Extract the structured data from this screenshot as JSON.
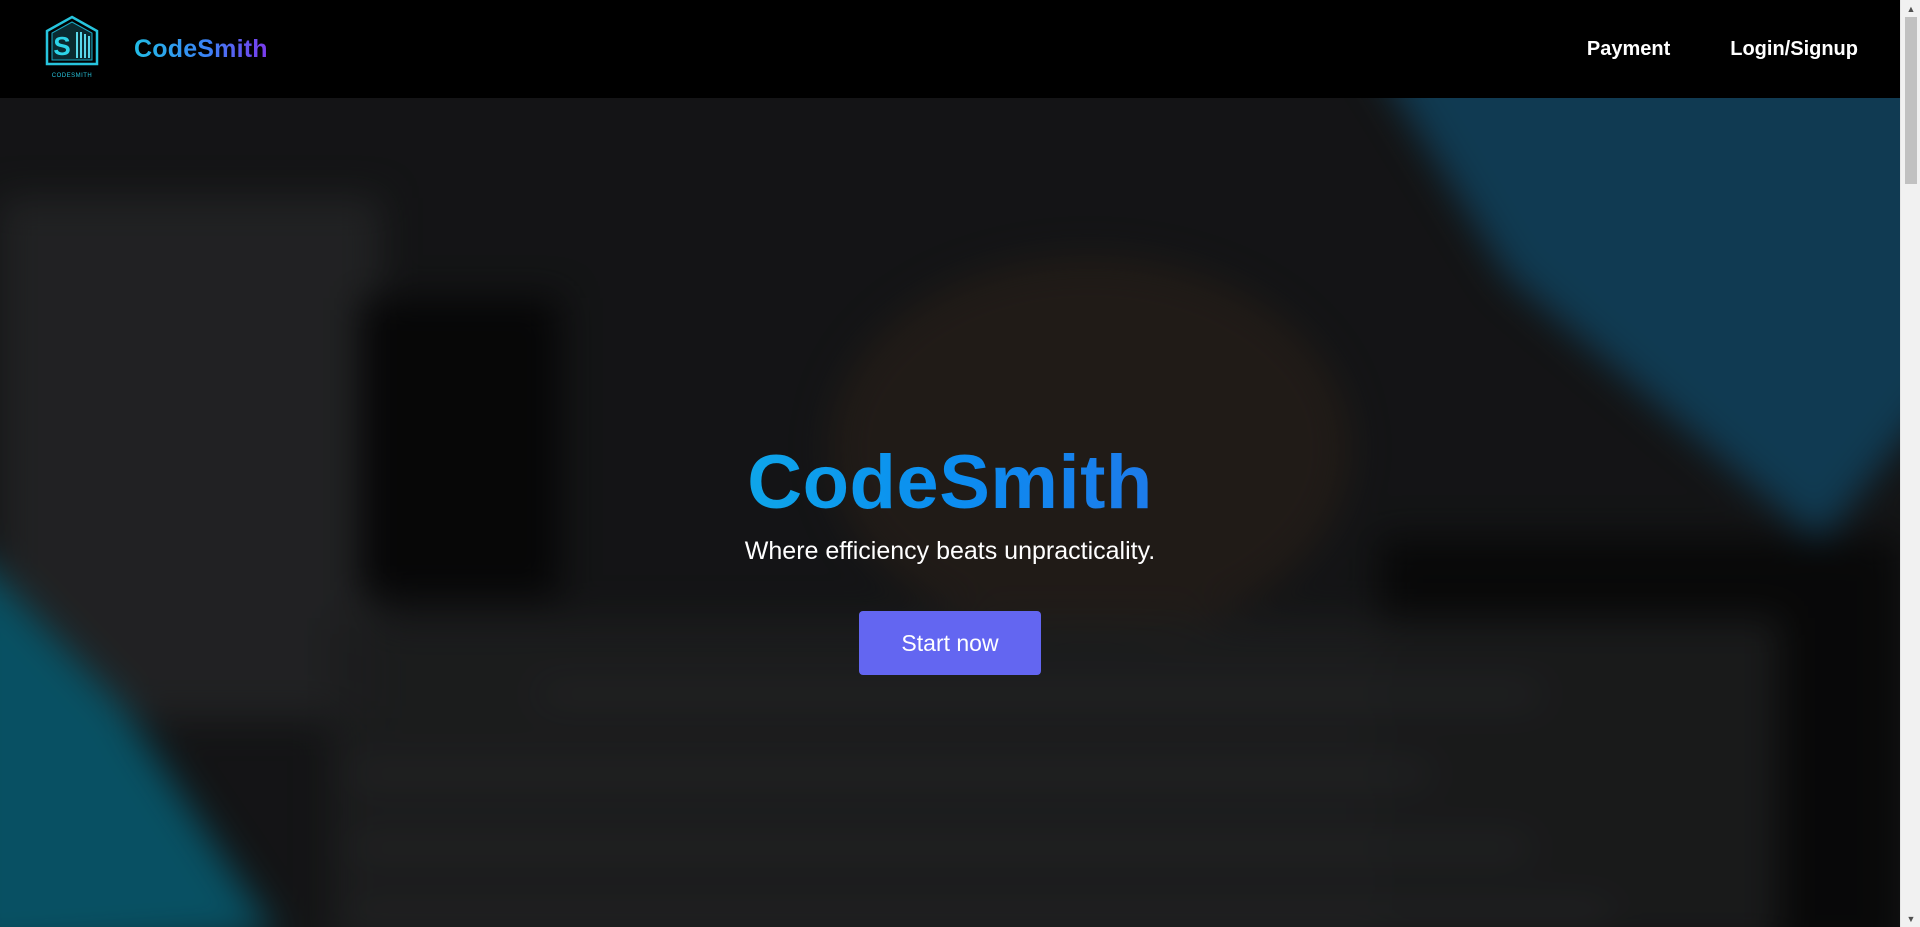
{
  "navbar": {
    "brand_name": "CodeSmith",
    "logo_text": "CODESMITH",
    "logo_letter": "S",
    "links": [
      {
        "label": "Payment"
      },
      {
        "label": "Login/Signup"
      }
    ]
  },
  "hero": {
    "title": "CodeSmith",
    "subtitle": "Where efficiency beats unpracticality.",
    "cta_label": "Start now"
  },
  "colors": {
    "navbar_bg": "#000000",
    "cta_bg": "#6366f1",
    "title_gradient_start": "#0ea5e9",
    "brand_gradient_end": "#7c3aed"
  },
  "scrollbar": {
    "up_icon": "triangle-up",
    "down_icon": "triangle-down"
  }
}
